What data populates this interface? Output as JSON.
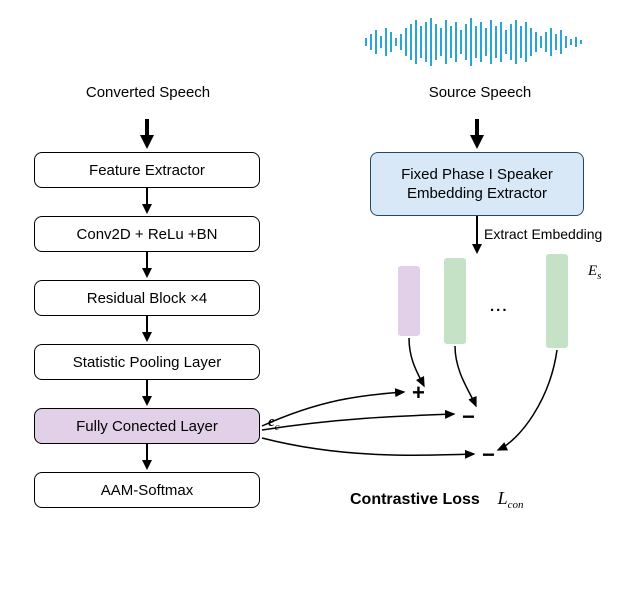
{
  "left": {
    "speech_label": "Converted Speech",
    "blocks": {
      "feature_extractor": "Feature Extractor",
      "conv2d": "Conv2D + ReLu +BN",
      "residual": "Residual Block  ×4",
      "stat_pool": "Statistic Pooling Layer",
      "fc": "Fully Conected Layer",
      "aam": "AAM-Softmax"
    },
    "ec_label": "e",
    "ec_sub": "c"
  },
  "right": {
    "speech_label": "Source Speech",
    "extractor": "Fixed Phase I Speaker\nEmbedding Extractor",
    "extract_label": "Extract Embedding",
    "es_label": "E",
    "es_sub": "s"
  },
  "contrastive": {
    "label": "Contrastive Loss",
    "lcon": "L",
    "lcon_sub": "con",
    "signs": {
      "plus": "+",
      "minus1": "−",
      "minus2": "−"
    }
  },
  "chart_data": {
    "type": "diagram",
    "title": "Two-branch speaker embedding architecture with contrastive loss",
    "left_branch": {
      "input": "Converted Speech",
      "layers": [
        "Feature Extractor",
        "Conv2D + ReLu + BN",
        "Residual Block ×4",
        "Statistic Pooling Layer",
        "Fully Connected Layer",
        "AAM-Softmax"
      ],
      "output_embedding": "e_c"
    },
    "right_branch": {
      "input": "Source Speech",
      "module": "Fixed Phase I Speaker Embedding Extractor",
      "output_embeddings": "E_s (set of embeddings)"
    },
    "loss": {
      "name": "Contrastive Loss L_con",
      "positive_pair": "e_c with first E_s embedding (+)",
      "negative_pairs": "e_c with remaining E_s embeddings (−)"
    }
  }
}
